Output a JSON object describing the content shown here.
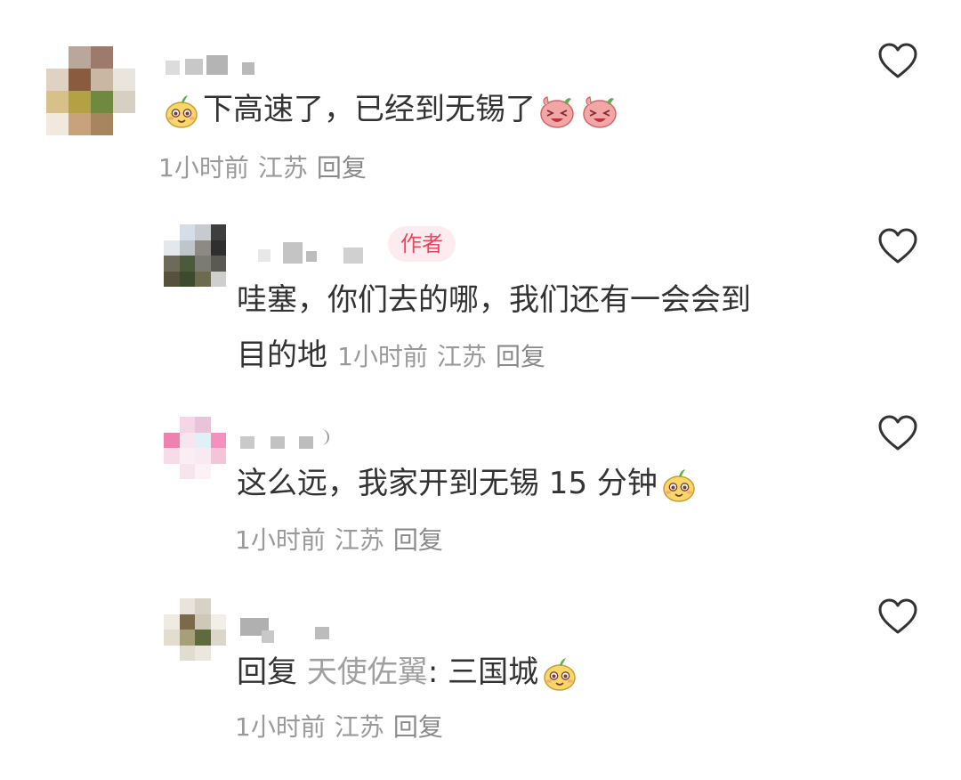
{
  "comments": [
    {
      "text_before": "下高速了，已经到无锡了",
      "time": "1小时前",
      "location": "江苏",
      "reply_label": "回复",
      "emojis": [
        "smiling-dumpling-emoji",
        "laughing-pink-emoji",
        "laughing-pink-emoji"
      ]
    },
    {
      "badge": "作者",
      "line1": "哇塞，你们去的哪，我们还有一会会到",
      "line2": "目的地",
      "time": "1小时前",
      "location": "江苏",
      "reply_label": "回复"
    },
    {
      "text": "这么远，我家开到无锡 15 分钟",
      "time": "1小时前",
      "location": "江苏",
      "reply_label": "回复",
      "emojis": [
        "smiling-dumpling-emoji"
      ]
    },
    {
      "reply_prefix": "回复",
      "reply_to": "天使佐翼",
      "separator": ":",
      "text": "三国城",
      "time": "1小时前",
      "location": "江苏",
      "reply_label": "回复",
      "emojis": [
        "smiling-dumpling-emoji"
      ]
    }
  ],
  "colors": {
    "text": "#333333",
    "meta": "#9a9a9a",
    "badge_bg": "#fdecef",
    "badge_text": "#e8475f",
    "heart_stroke": "#333333"
  },
  "icons": [
    "heart-outline-icon"
  ]
}
